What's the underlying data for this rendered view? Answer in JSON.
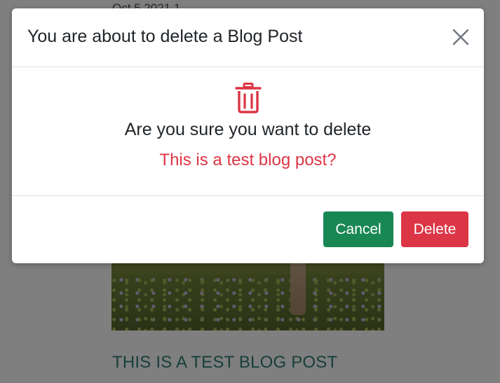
{
  "background_page": {
    "post_date": "Oct 5 2021 1",
    "post_title": "THIS IS A TEST BLOG POST"
  },
  "modal": {
    "title": "You are about to delete a Blog Post",
    "body": {
      "icon": "trash-icon",
      "confirm_text": "Are you sure you want to delete",
      "target_title": "This is a test blog post?"
    },
    "footer": {
      "cancel_label": "Cancel",
      "delete_label": "Delete"
    },
    "close_icon": "close-icon"
  },
  "colors": {
    "danger": "#dc3545",
    "success": "#198754",
    "accent_title": "#2e7d74",
    "backdrop": "rgba(0,0,0,0.5)"
  }
}
